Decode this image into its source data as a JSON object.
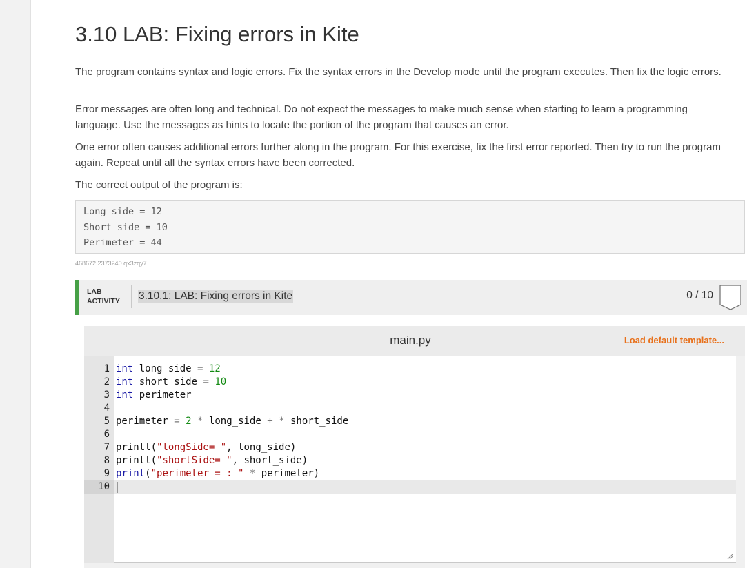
{
  "page": {
    "title": "3.10 LAB: Fixing errors in Kite",
    "paragraphs": [
      "The program contains syntax and logic errors. Fix the syntax errors in the Develop mode until the program executes. Then fix the logic errors.",
      "Error messages are often long and technical. Do not expect the messages to make much sense when starting to learn a programming language. Use the messages as hints to locate the portion of the program that causes an error.",
      "One error often causes additional errors further along in the program. For this exercise, fix the first error reported. Then try to run the program again. Repeat until all the syntax errors have been corrected.",
      "The correct output of the program is:"
    ],
    "expected_output": [
      "Long side = 12",
      "Short side = 10",
      "Perimeter = 44"
    ],
    "hash_id": "468672.2373240.qx3zqy7"
  },
  "lab": {
    "tag_line1": "LAB",
    "tag_line2": "ACTIVITY",
    "title": "3.10.1: LAB: Fixing errors in Kite",
    "score": "0 / 10",
    "accent_color": "#46a046"
  },
  "editor": {
    "filename": "main.py",
    "load_template_label": "Load default template...",
    "load_template_color": "#e8711c",
    "line_numbers": [
      "1",
      "2",
      "3",
      "4",
      "5",
      "6",
      "7",
      "8",
      "9",
      "10"
    ],
    "lines": [
      "int long_side = 12",
      "int short_side = 10",
      "int perimeter",
      "",
      "perimeter = 2 * long_side + * short_side",
      "",
      "printl(\"longSide= \", long_side)",
      "printl(\"shortSide= \", short_side)",
      "print(\"perimeter = : \" * perimeter)",
      ""
    ],
    "active_line": 10
  }
}
